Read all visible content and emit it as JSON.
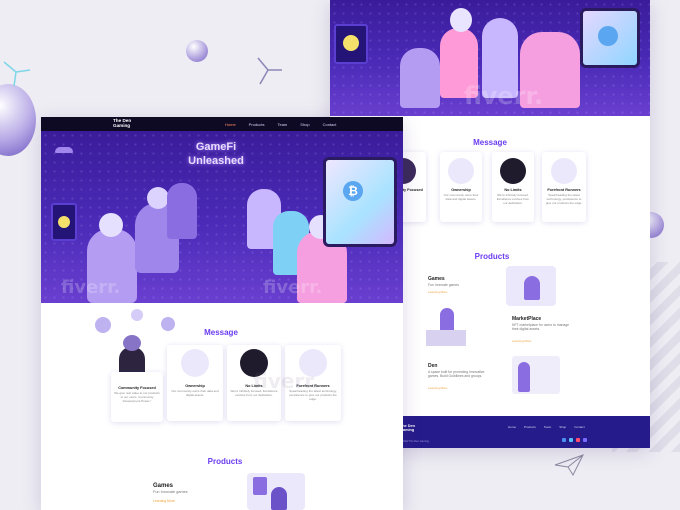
{
  "nav": {
    "logo": "The Den Gaming",
    "links": [
      "Home",
      "Products",
      "Team",
      "Shop",
      "Contact"
    ],
    "active": "Home"
  },
  "hero": {
    "title_line1": "GameFi",
    "title_line2": "Unleashed"
  },
  "watermark": "fiverr.",
  "message": {
    "title": "Message",
    "cards": [
      {
        "name": "Community Focused",
        "desc": "We give real value to our products to our users. Community Development Power !"
      },
      {
        "name": "Ownership",
        "desc": "Our community owns their data and digital assets."
      },
      {
        "name": "No Limits",
        "desc": "We're Infinitely focused. Excellence evolves from our dedication."
      },
      {
        "name": "Forefront Runners",
        "desc": "Spearheading the latest technology, persistence to give our products the edge."
      }
    ]
  },
  "products": {
    "title": "Products",
    "items": [
      {
        "name": "Games",
        "desc": "Fun Innovate games",
        "link": "Learning More"
      },
      {
        "name": "MarketPlace",
        "desc": "NFT marketplace for users to manage their digital assets.",
        "link": "Learning More"
      },
      {
        "name": "Den",
        "desc": "A space built for promoting innovative games, Build Guildlines and groups.",
        "link": "Learning More"
      }
    ]
  },
  "footer": {
    "logo": "The Den Gaming",
    "links": [
      "Home",
      "Products",
      "Team",
      "Shop",
      "Contact"
    ],
    "copyright": "© 2022 The Den Gaming"
  },
  "colors": {
    "accent": "#6b3df0",
    "hero": "#3a1c9a",
    "footer": "#261b8a",
    "link": "#f2a23a",
    "nav_active": "#ff8a5b"
  }
}
